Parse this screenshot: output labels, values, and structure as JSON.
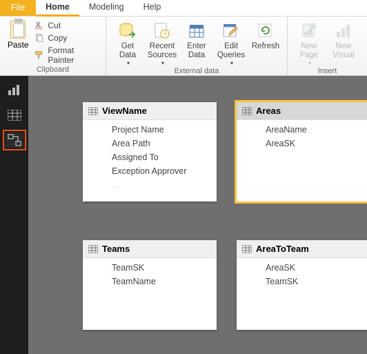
{
  "tabs": {
    "file": "File",
    "home": "Home",
    "modeling": "Modeling",
    "help": "Help"
  },
  "ribbon": {
    "clipboard": {
      "label": "Clipboard",
      "paste": "Paste",
      "cut": "Cut",
      "copy": "Copy",
      "format_painter": "Format Painter"
    },
    "external": {
      "label": "External data",
      "get": "Get\nData",
      "recent": "Recent\nSources",
      "enter": "Enter\nData",
      "edit": "Edit\nQueries",
      "refresh": "Refresh"
    },
    "insert": {
      "label": "Insert",
      "newpage": "New\nPage",
      "newvisual": "New\nVisual"
    }
  },
  "tables": {
    "viewname": {
      "title": "ViewName",
      "fields": [
        "Project Name",
        "Area Path",
        "Assigned To",
        "Exception Approver"
      ]
    },
    "areas": {
      "title": "Areas",
      "fields": [
        "AreaName",
        "AreaSK"
      ]
    },
    "teams": {
      "title": "Teams",
      "fields": [
        "TeamSK",
        "TeamName"
      ]
    },
    "areatoteam": {
      "title": "AreaToTeam",
      "fields": [
        "AreaSK",
        "TeamSK"
      ]
    }
  }
}
